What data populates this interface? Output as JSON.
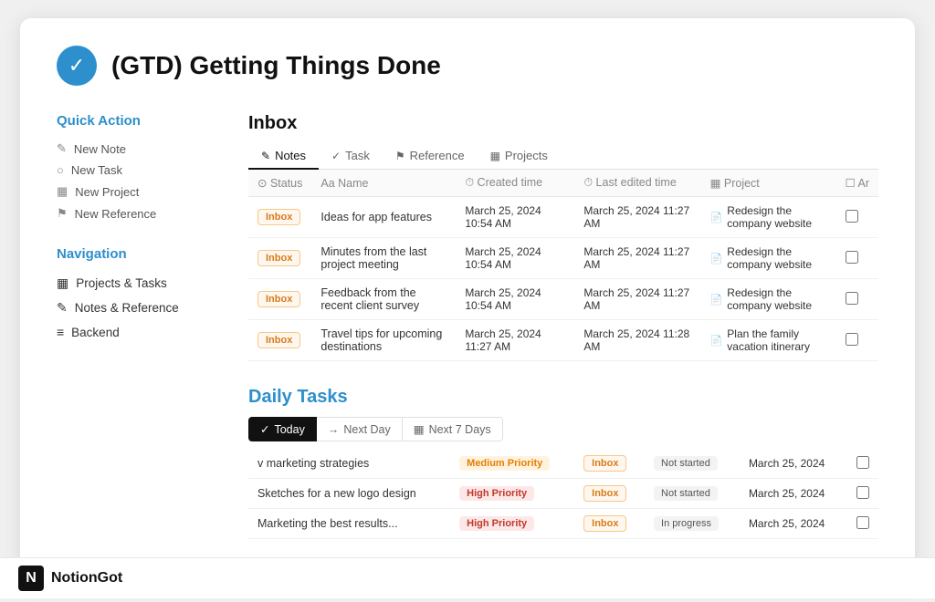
{
  "page": {
    "icon": "✓",
    "title": "(GTD) Getting Things Done"
  },
  "sidebar": {
    "quick_action_title": "Quick Action",
    "actions": [
      {
        "icon": "✎",
        "label": "New Note"
      },
      {
        "icon": "○",
        "label": "New Task"
      },
      {
        "icon": "▦",
        "label": "New Project"
      },
      {
        "icon": "⚑",
        "label": "New Reference"
      }
    ],
    "navigation_title": "Navigation",
    "nav_items": [
      {
        "icon": "▦",
        "label": "Projects & Tasks"
      },
      {
        "icon": "✎",
        "label": "Notes & Reference"
      },
      {
        "icon": "≡",
        "label": "Backend"
      }
    ]
  },
  "inbox": {
    "title": "Inbox",
    "tabs": [
      {
        "icon": "✎",
        "label": "Notes",
        "active": true
      },
      {
        "icon": "✓",
        "label": "Task",
        "active": false
      },
      {
        "icon": "⚑",
        "label": "Reference",
        "active": false
      },
      {
        "icon": "▦",
        "label": "Projects",
        "active": false
      }
    ],
    "columns": [
      "Status",
      "Name",
      "Created time",
      "Last edited time",
      "Project",
      "Ar"
    ],
    "rows": [
      {
        "status": "Inbox",
        "name": "Ideas for app features",
        "created": "March 25, 2024 10:54 AM",
        "edited": "March 25, 2024 11:27 AM",
        "project": "Redesign the company website"
      },
      {
        "status": "Inbox",
        "name": "Minutes from the last project meeting",
        "created": "March 25, 2024 10:54 AM",
        "edited": "March 25, 2024 11:27 AM",
        "project": "Redesign the company website"
      },
      {
        "status": "Inbox",
        "name": "Feedback from the recent client survey",
        "created": "March 25, 2024 10:54 AM",
        "edited": "March 25, 2024 11:27 AM",
        "project": "Redesign the company website"
      },
      {
        "status": "Inbox",
        "name": "Travel tips for upcoming destinations",
        "created": "March 25, 2024 11:27 AM",
        "edited": "March 25, 2024 11:28 AM",
        "project": "Plan the family vacation itinerary"
      }
    ]
  },
  "daily_tasks": {
    "title": "Daily Tasks",
    "tabs": [
      {
        "icon": "✓",
        "label": "Today",
        "active": true
      },
      {
        "icon": "→",
        "label": "Next Day",
        "active": false
      },
      {
        "icon": "▦",
        "label": "Next 7 Days",
        "active": false
      }
    ],
    "rows": [
      {
        "name": "v marketing strategies",
        "priority": "Medium Priority",
        "priority_type": "medium",
        "status_badge": "Inbox",
        "status": "Not started",
        "date": "March 25, 2024"
      },
      {
        "name": "Sketches for a new logo design",
        "priority": "High Priority",
        "priority_type": "high",
        "status_badge": "Inbox",
        "status": "Not started",
        "date": "March 25, 2024"
      },
      {
        "name": "Marketing the best results...",
        "priority": "High Priority",
        "priority_type": "high",
        "status_badge": "Inbox",
        "status": "In progress",
        "date": "March 25, 2024"
      }
    ]
  },
  "bottom_bar": {
    "logo_letter": "N",
    "brand_name": "NotionGot"
  },
  "colors": {
    "accent": "#2d8fcb",
    "title": "#111111",
    "sidebar_title": "#2d8fcb"
  }
}
